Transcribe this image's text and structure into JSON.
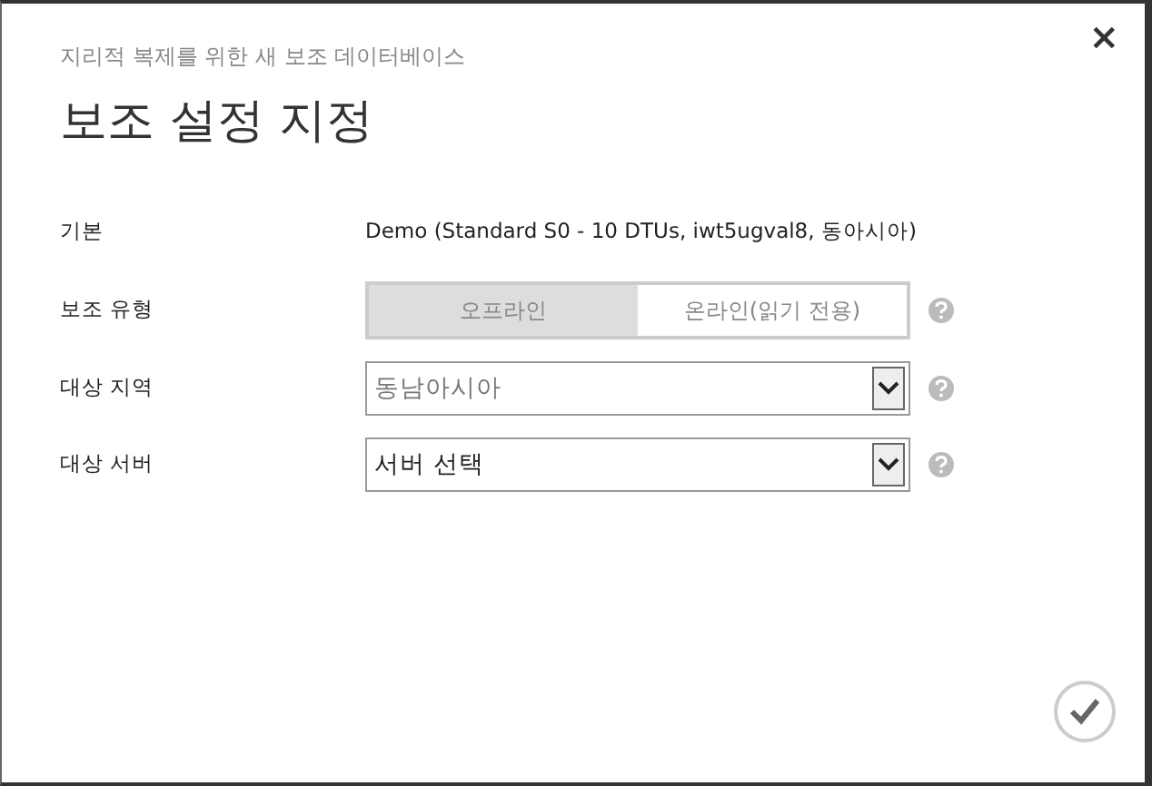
{
  "dialog": {
    "subtitle": "지리적 복제를 위한 새 보조 데이터베이스",
    "title": "보조 설정 지정",
    "close": "×"
  },
  "fields": [
    {
      "kind": "text",
      "label": "기본",
      "value": "Demo (Standard S0 - 10 DTUs, iwt5ugval8, 동아시아)",
      "help": false
    },
    {
      "kind": "toggle",
      "label": "보조 유형",
      "options": [
        {
          "label": "오프라인",
          "selected": true
        },
        {
          "label": "온라인(읽기 전용)",
          "selected": false
        }
      ],
      "help": true
    },
    {
      "kind": "select",
      "label": "대상 지역",
      "value": "동남아시아",
      "disabled": true,
      "help": true
    },
    {
      "kind": "select",
      "label": "대상 서버",
      "value": "서버 선택",
      "disabled": false,
      "help": true
    }
  ]
}
